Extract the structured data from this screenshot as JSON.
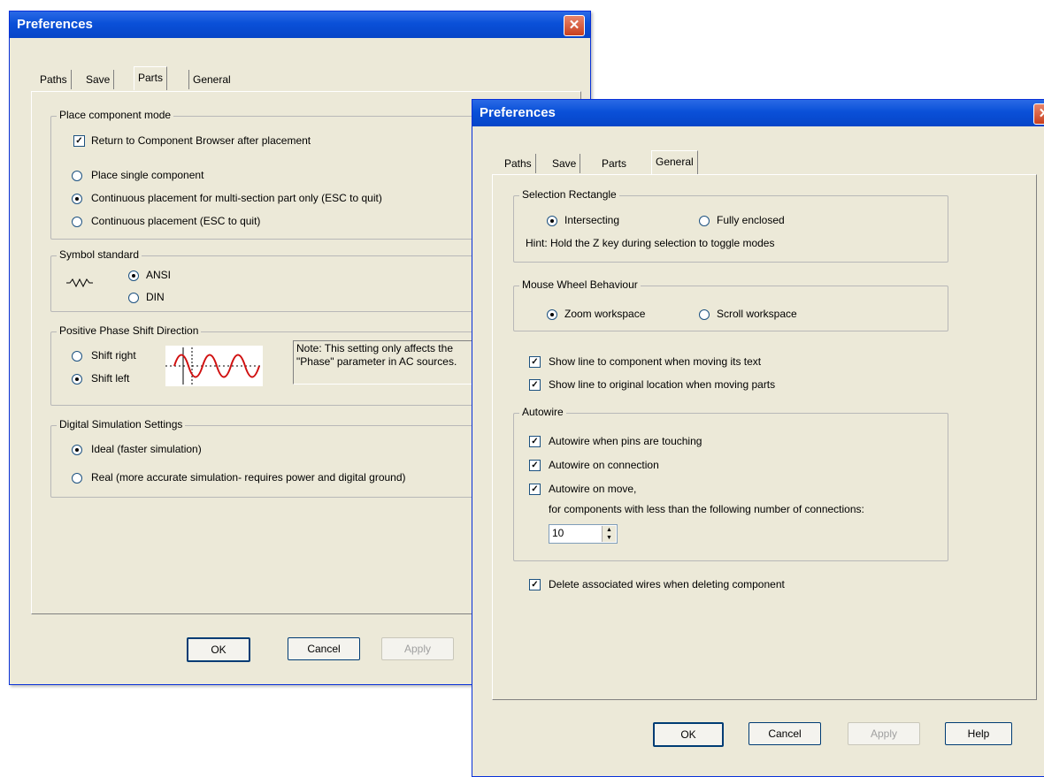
{
  "dialog_back": {
    "title": "Preferences",
    "tabs": [
      "Paths",
      "Save",
      "Parts",
      "General"
    ],
    "active_tab": "Parts",
    "place_mode": {
      "legend": "Place component mode",
      "return_label": "Return to Component Browser after placement",
      "return_checked": true,
      "single": "Place single component",
      "multi": "Continuous placement for multi-section part only (ESC to quit)",
      "continuous": "Continuous placement (ESC to quit)",
      "selected": "multi"
    },
    "symbol": {
      "legend": "Symbol standard",
      "ansi": "ANSI",
      "din": "DIN",
      "selected": "ANSI"
    },
    "phase": {
      "legend": "Positive Phase Shift Direction",
      "right": "Shift right",
      "left": "Shift left",
      "selected": "left",
      "note": "Note: This setting only affects the \"Phase\" parameter in AC sources."
    },
    "digital": {
      "legend": "Digital Simulation Settings",
      "ideal": "Ideal (faster simulation)",
      "real": "Real (more accurate simulation- requires power and digital ground)",
      "selected": "ideal"
    },
    "buttons": {
      "ok": "OK",
      "cancel": "Cancel",
      "apply": "Apply"
    }
  },
  "dialog_front": {
    "title": "Preferences",
    "tabs": [
      "Paths",
      "Save",
      "Parts",
      "General"
    ],
    "active_tab": "General",
    "selection": {
      "legend": "Selection Rectangle",
      "intersecting": "Intersecting",
      "fully": "Fully enclosed",
      "selected": "Intersecting",
      "hint": "Hint: Hold the Z key during selection to toggle modes"
    },
    "mouse": {
      "legend": "Mouse Wheel Behaviour",
      "zoom": "Zoom workspace",
      "scroll": "Scroll workspace",
      "selected": "Zoom workspace"
    },
    "show_line_text": "Show line to component when moving its text",
    "show_line_orig": "Show line to original location when moving parts",
    "autowire": {
      "legend": "Autowire",
      "touching": "Autowire when pins are touching",
      "connection": "Autowire on connection",
      "move": "Autowire on move,",
      "move_note": "for components with less than the following number of connections:",
      "count": "10"
    },
    "delete_wires": "Delete associated wires when deleting component",
    "buttons": {
      "ok": "OK",
      "cancel": "Cancel",
      "apply": "Apply",
      "help": "Help"
    }
  }
}
